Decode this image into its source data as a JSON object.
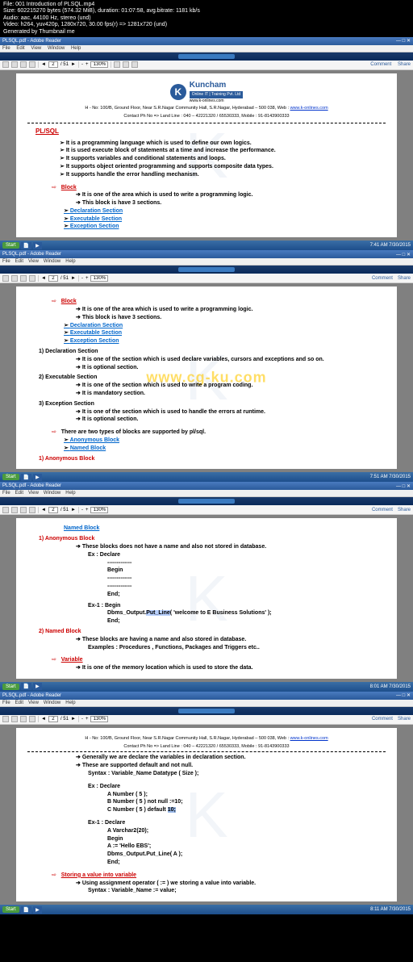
{
  "meta": {
    "file": "File: 001 Introduction of PLSQL.mp4",
    "size": "Size: 602215270 bytes (574.32 MiB), duration: 01:07:58, avg.bitrate: 1181 kb/s",
    "audio": "Audio: aac, 44100 Hz, stereo (und)",
    "video": "Video: h264, yuv420p, 1280x720, 30.00 fps(r) => 1281x720 (und)",
    "gen": "Generated by Thumbnail me"
  },
  "reader": {
    "title": "PLSQL.pdf - Adobe Reader",
    "menus": [
      "File",
      "Edit",
      "View",
      "Window",
      "Help"
    ],
    "page": "2",
    "pages": "51",
    "zoom": "130%",
    "comment": "Comment",
    "share": "Share"
  },
  "taskbar": {
    "start": "Start",
    "clock1": "7:41 AM 7/30/2015",
    "clock2": "7:51 AM 7/30/2015",
    "clock3": "8:01 AM 7/30/2015",
    "clock4": "8:11 AM 7/30/2015"
  },
  "company": {
    "brand": "Kuncham",
    "tag1": "Online IT",
    "tag2": "Training Pvt. Ltd",
    "url": "www.k-onlines.com",
    "addr": "H - No: 100/B, Ground Floor, Near S.R.Nagar Community Hall, S.R.Nagar, Hyderabad – 500 038,  Web : ",
    "contact": "Contact Ph No =>   Land Line : 040 – 42221320 / 65530333, Mobile : 91-8143900333"
  },
  "panel1": {
    "heading": "PL/SQL",
    "bullets": [
      "It is a programming language which is used to define our own logics.",
      "It is used execute block of statements at a time and increase the performance.",
      "It supports variables and conditional statements and loops.",
      "It supports object oriented programming and supports composite data types.",
      "It supports handle the error handling mechanism."
    ],
    "block": "Block",
    "block_desc": [
      "It is one of the area which is used to write a programming logic.",
      "This block is have 3 sections."
    ],
    "sections": [
      "Declaration Section",
      "Executable Section",
      "Exception Section"
    ]
  },
  "panel2": {
    "block": "Block",
    "block_desc": [
      "It is one of the area which is used to write a programming logic.",
      "This block is have 3 sections."
    ],
    "sections": [
      "Declaration Section",
      "Executable Section",
      "Exception Section"
    ],
    "decl_num": "1)   Declaration Section",
    "decl_desc": [
      "It is one of the section which is used declare variables, cursors and exceptions and so on.",
      "It is optional section."
    ],
    "exec_num": "2)   Executable Section",
    "exec_desc": [
      "It is one of the section which is used to write a program coding.",
      "It is mandatory section."
    ],
    "excp_num": "3)   Exception Section",
    "excp_desc": [
      "It is one of the section which is used to handle the errors at runtime.",
      "It is optional section."
    ],
    "two_types": "There are two types of blocks are supported by pl/sql.",
    "types": [
      "Anonymous Block",
      "Named Block"
    ],
    "anon_h": "1)   Anonymous Block",
    "watermark": "www.cg-ku.com"
  },
  "panel3": {
    "named_cut": "Named Block",
    "anon_h": "1)   Anonymous Block",
    "anon_desc": "These blocks does not have a name and also not stored in database.",
    "ex_label": "Ex : Declare",
    "dashes": "-------------",
    "begin": "Begin",
    "end": "End;",
    "ex1_label": "Ex-1 :  Begin",
    "ex1_code": "Dbms_Output.",
    "ex1_func": "Put_Line",
    "ex1_args": "( 'welcome to E Business Solutions' );",
    "ex1_end": "End;",
    "named_h": "2)   Named Block",
    "named_desc1": "These blocks are having a name and also stored in database.",
    "named_desc2": "Examples : Procedures , Functions, Packages and Triggers etc..",
    "var_h": "Variable",
    "var_desc": "It is one of the memory location which is used to store the data."
  },
  "panel4": {
    "var_desc1": "Generally we are declare the variables in declaration section.",
    "var_desc2": "These are supported default and not null.",
    "syntax": "Syntax : Variable_Name          Datatype ( Size );",
    "ex_label": "Ex :  Declare",
    "ex_a": "A       Number ( 5 );",
    "ex_b": "B       Number ( 5 )  not null :=10;",
    "ex_c_pre": "C       Number ( 5 )  default      ",
    "ex_c_val": "10;",
    "ex1_label": "Ex-1 :  Declare",
    "ex1_a": "A  Varchar2(20);",
    "ex1_begin": "Begin",
    "ex1_assign": "A := 'Hello EBS';",
    "ex1_out": "Dbms_Output.Put_Line( A );",
    "ex1_end": "End;",
    "store_h": "Storing a value into variable",
    "store_desc": "Using assignment operator  ( := )  we storing a value into variable.",
    "store_syntax": "Syntax : Variable_Name    :=   value;"
  }
}
